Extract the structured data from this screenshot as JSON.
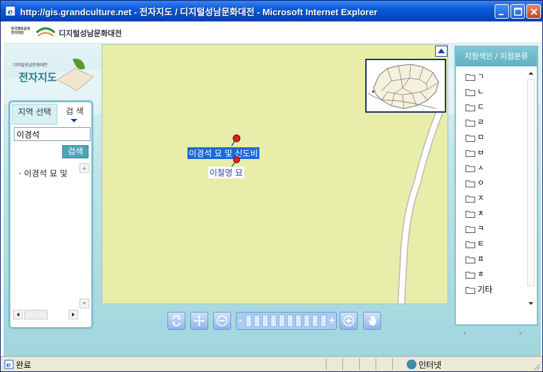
{
  "window": {
    "title": "http://gis.grandculture.net - 전자지도 / 디지털성남문화대전 - Microsoft Internet Explorer"
  },
  "header": {
    "institution_line1": "한국향토문화",
    "institution_line2": "전자대전",
    "site_name": "디지털성남문화대전"
  },
  "side_logo": {
    "small_text": "디지털성남문화대전",
    "big_text": "전자지도"
  },
  "left_panel": {
    "tabs": [
      {
        "label": "지역 선택"
      },
      {
        "label": "검 색"
      }
    ],
    "search_value": "이경석",
    "search_button": "검색",
    "results": [
      {
        "label": "· 이경석 묘 및"
      }
    ]
  },
  "map": {
    "markers": [
      {
        "label": "이경석 묘 및 신도비"
      },
      {
        "label": "이철영 묘"
      }
    ],
    "road_color": "#ffffff",
    "land_color": "#e8edaa"
  },
  "toolbar": {
    "zoom_minus": "-",
    "zoom_plus": "+",
    "tools": [
      "refresh-icon",
      "pan-icon",
      "zoom-out-icon",
      "zoom-in-icon",
      "hand-icon"
    ]
  },
  "right_panel": {
    "header": "지점색인 / 지점분류",
    "items": [
      "ㄱ",
      "ㄴ",
      "ㄷ",
      "ㄹ",
      "ㅁ",
      "ㅂ",
      "ㅅ",
      "ㅇ",
      "ㅈ",
      "ㅊ",
      "ㅋ",
      "ㅌ",
      "ㅍ",
      "ㅎ",
      "기타"
    ]
  },
  "statusbar": {
    "status": "완료",
    "zone": "인터넷"
  }
}
